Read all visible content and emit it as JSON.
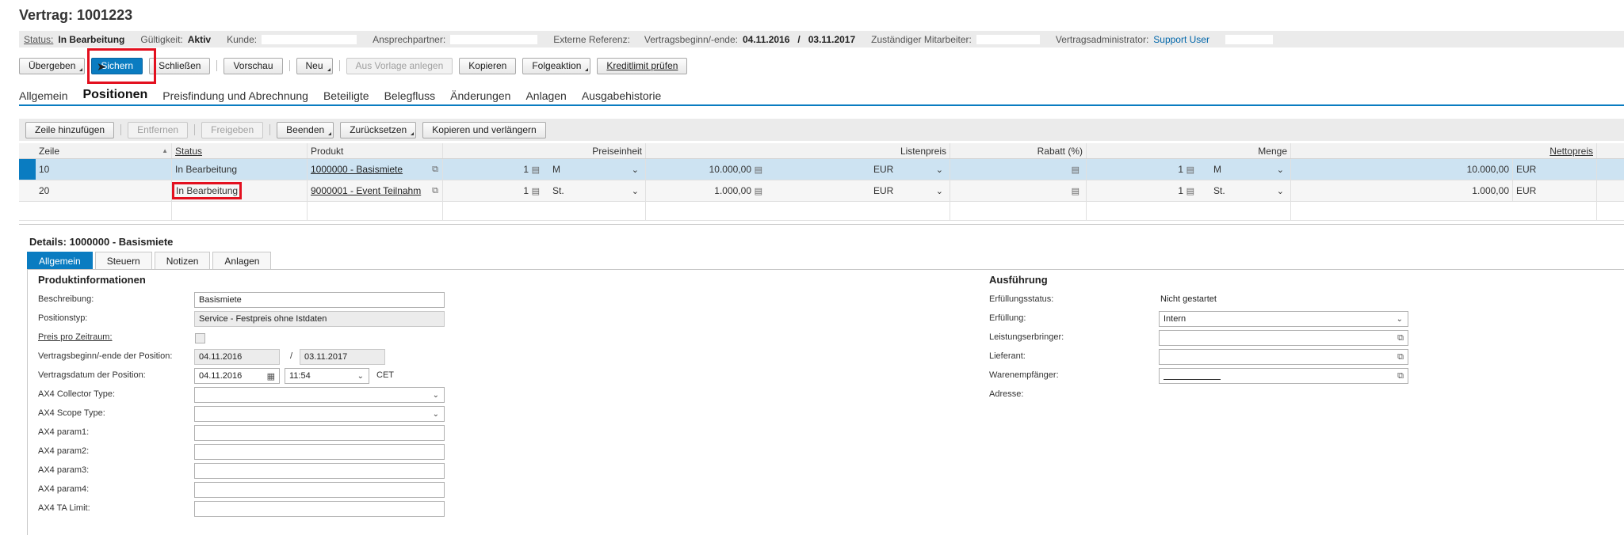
{
  "title": "Vertrag: 1001223",
  "infobar": {
    "status_label": "Status:",
    "status_value": "In Bearbeitung",
    "validity_label": "Gültigkeit:",
    "validity_value": "Aktiv",
    "customer_label": "Kunde:",
    "contact_label": "Ansprechpartner:",
    "extref_label": "Externe Referenz:",
    "period_label": "Vertragsbeginn/-ende:",
    "period_start": "04.11.2016",
    "period_sep": "/",
    "period_end": "03.11.2017",
    "employee_label": "Zuständiger Mitarbeiter:",
    "admin_label": "Vertragsadministrator:",
    "admin_value": "Support User"
  },
  "toolbar": {
    "handover": "Übergeben",
    "save": "Sichern",
    "close": "Schließen",
    "preview": "Vorschau",
    "new": "Neu",
    "from_template": "Aus Vorlage anlegen",
    "copy": "Kopieren",
    "follow_up": "Folgeaktion",
    "credit_check": "Kreditlimit prüfen"
  },
  "tabs": [
    "Allgemein",
    "Positionen",
    "Preisfindung und Abrechnung",
    "Beteiligte",
    "Belegfluss",
    "Änderungen",
    "Anlagen",
    "Ausgabehistorie"
  ],
  "table_toolbar": {
    "add_row": "Zeile hinzufügen",
    "remove": "Entfernen",
    "release": "Freigeben",
    "finish": "Beenden",
    "reset": "Zurücksetzen",
    "copy_extend": "Kopieren und verlängern"
  },
  "table": {
    "headers": [
      "Zeile",
      "Status",
      "Produkt",
      "Preiseinheit",
      "Listenpreis",
      "Rabatt (%)",
      "Menge",
      "Nettopreis"
    ],
    "rows": [
      {
        "line": "10",
        "status": "In Bearbeitung",
        "product": "1000000 - Basismiete",
        "pu_qty": "1",
        "pu_unit": "M",
        "list_price": "10.000,00",
        "currency": "EUR",
        "qty": "1",
        "qty_unit": "M",
        "net_price": "10.000,00",
        "net_currency": "EUR"
      },
      {
        "line": "20",
        "status": "In Bearbeitung",
        "product": "9000001 - Event Teilnahm",
        "pu_qty": "1",
        "pu_unit": "St.",
        "list_price": "1.000,00",
        "currency": "EUR",
        "qty": "1",
        "qty_unit": "St.",
        "net_price": "1.000,00",
        "net_currency": "EUR"
      }
    ]
  },
  "details": {
    "title_label": "Details:",
    "title_value": "1000000 - Basismiete",
    "tabs": [
      "Allgemein",
      "Steuern",
      "Notizen",
      "Anlagen"
    ],
    "product_info": {
      "heading": "Produktinformationen",
      "description_label": "Beschreibung:",
      "description_value": "Basismiete",
      "postype_label": "Positionstyp:",
      "postype_value": "Service - Festpreis ohne Istdaten",
      "price_per_period_label": "Preis pro Zeitraum:",
      "period_label": "Vertragsbeginn/-ende der Position:",
      "period_start": "04.11.2016",
      "period_sep": "/",
      "period_end": "03.11.2017",
      "date_label": "Vertragsdatum der Position:",
      "date_value": "04.11.2016",
      "time_value": "11:54",
      "timezone": "CET",
      "collector_label": "AX4 Collector Type:",
      "scope_label": "AX4 Scope Type:",
      "param1_label": "AX4 param1:",
      "param2_label": "AX4 param2:",
      "param3_label": "AX4 param3:",
      "param4_label": "AX4 param4:",
      "ta_limit_label": "AX4 TA Limit:"
    },
    "execution": {
      "heading": "Ausführung",
      "fulfillment_status_label": "Erfüllungsstatus:",
      "fulfillment_status_value": "Nicht gestartet",
      "fulfillment_label": "Erfüllung:",
      "fulfillment_value": "Intern",
      "provider_label": "Leistungserbringer:",
      "supplier_label": "Lieferant:",
      "recipient_label": "Warenempfänger:",
      "address_label": "Adresse:"
    }
  },
  "colors": {
    "accent": "#0a7cc1",
    "highlight": "#e3101f"
  }
}
